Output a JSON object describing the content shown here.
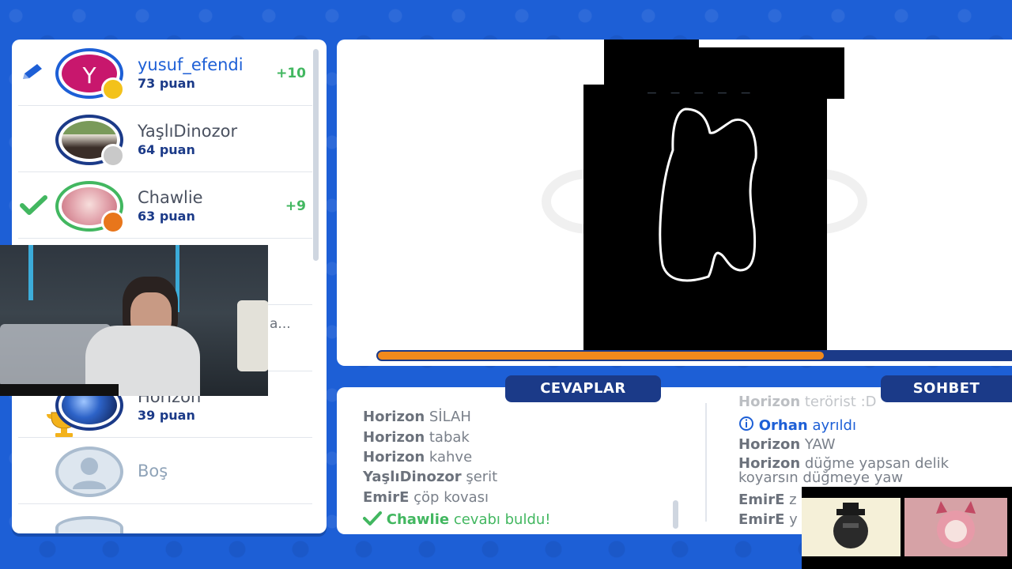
{
  "players": [
    {
      "name": "yusuf_efendi",
      "score": "73 puan",
      "gain": "+10",
      "avatar_letter": "Y",
      "is_drawer": true,
      "dot_color": "#f3c21b",
      "avatar_bg": "#c8176d"
    },
    {
      "name": "YaşlıDinozor",
      "score": "64 puan",
      "gain": "",
      "dot_color": "#c9c9c9"
    },
    {
      "name": "Chawlie",
      "score": "63 puan",
      "gain": "+9",
      "found": true,
      "dot_color": "#e8761b"
    },
    {
      "name": "Horizon",
      "score": "39 puan",
      "rank": "1"
    },
    {
      "name": "Boş"
    }
  ],
  "partial_hidden_text": "a...",
  "canvas": {
    "word_hint": "_ _ _ _ _",
    "timer_fraction": 0.7
  },
  "answers": {
    "tab_label": "CEVAPLAR",
    "messages": [
      {
        "user": "Horizon",
        "text": "SİLAH"
      },
      {
        "user": "Horizon",
        "text": "tabak"
      },
      {
        "user": "Horizon",
        "text": "kahve"
      },
      {
        "user": "YaşlıDinozor",
        "text": "şerit"
      },
      {
        "user": "EmirE",
        "text": "çöp kovası"
      }
    ],
    "found_message": {
      "user": "Chawlie",
      "text": "cevabı buldu!"
    }
  },
  "chat": {
    "tab_label": "SOHBET",
    "messages": [
      {
        "user": "Horizon",
        "text": "terörist :D"
      },
      {
        "user": "Orhan",
        "text": "ayrıldı",
        "info": true
      },
      {
        "user": "Horizon",
        "text": "YAW"
      },
      {
        "user": "Horizon",
        "text": "düğme yapsan delik",
        "text2": "koyarsın düğmeye yaw"
      },
      {
        "user": "EmirE",
        "text": "z"
      },
      {
        "user": "EmirE",
        "text": "y"
      }
    ]
  },
  "colors": {
    "brand_blue": "#1d5fd6",
    "navy": "#1b3a88",
    "success_green": "#42b760",
    "timer_orange": "#f18a1c"
  }
}
